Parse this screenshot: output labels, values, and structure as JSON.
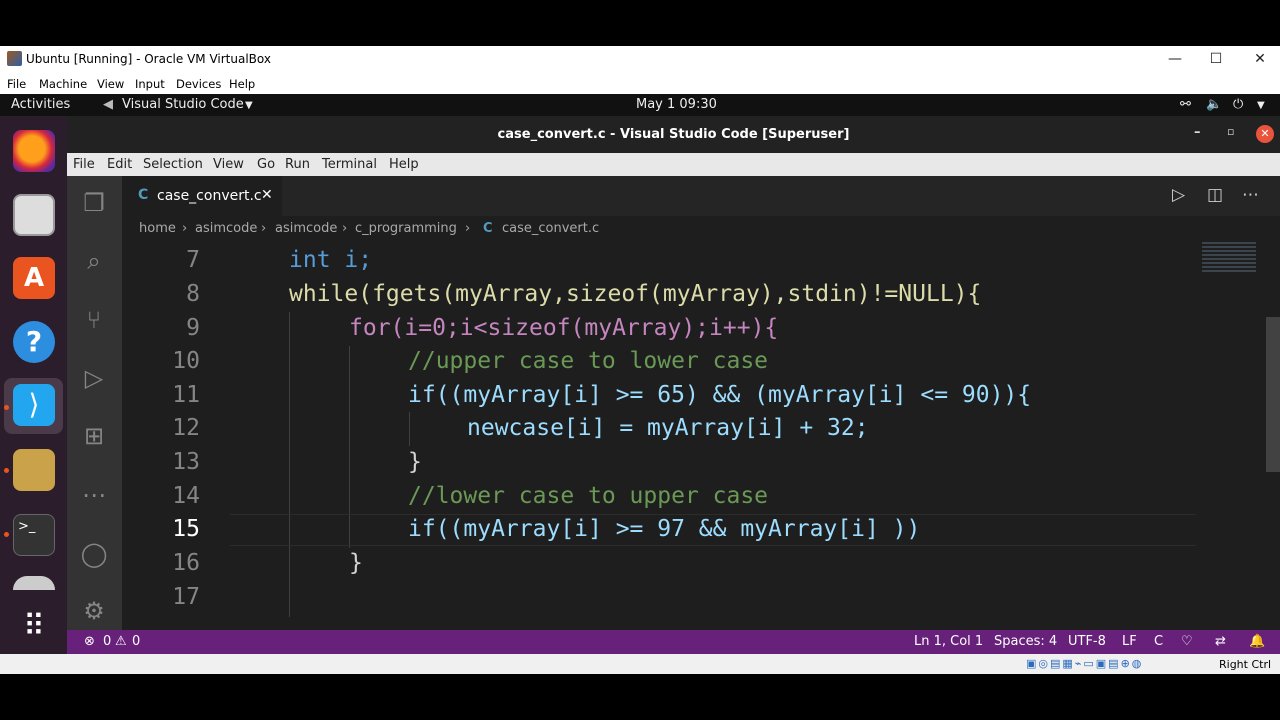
{
  "vbox": {
    "title": "Ubuntu [Running] - Oracle VM VirtualBox",
    "menu": [
      "File",
      "Machine",
      "View",
      "Input",
      "Devices",
      "Help"
    ],
    "host_key": "Right Ctrl"
  },
  "gnome": {
    "activities": "Activities",
    "app": "Visual Studio Code",
    "clock": "May 1  09:30"
  },
  "vscode": {
    "title": "case_convert.c - Visual Studio Code [Superuser]",
    "menu": [
      "File",
      "Edit",
      "Selection",
      "View",
      "Go",
      "Run",
      "Terminal",
      "Help"
    ],
    "tab": {
      "lang_badge": "C",
      "label": "case_convert.c"
    },
    "breadcrumb": [
      "home",
      "asimcode",
      "asimcode",
      "c_programming",
      "case_convert.c"
    ],
    "line_numbers": [
      "7",
      "8",
      "9",
      "10",
      "11",
      "12",
      "13",
      "14",
      "15",
      "16",
      "17"
    ],
    "status": {
      "errors": "0",
      "warnings": "0",
      "cursor": "Ln 1, Col 1",
      "spaces": "Spaces: 4",
      "encoding": "UTF-8",
      "eol": "LF",
      "language": "C"
    },
    "accent_status_color": "#68217a",
    "code_lines": [
      "int i;",
      "while(fgets(myArray,sizeof(myArray),stdin)!=NULL){",
      "for(i=0;i<sizeof(myArray);i++){",
      "//upper case to lower case",
      "if((myArray[i] >= 65) && (myArray[i] <= 90)){",
      "newcase[i] = myArray[i] + 32;",
      "}",
      "//lower case to upper case",
      "if((myArray[i] >= 97 && myArray[i] ))",
      "}",
      ""
    ]
  }
}
